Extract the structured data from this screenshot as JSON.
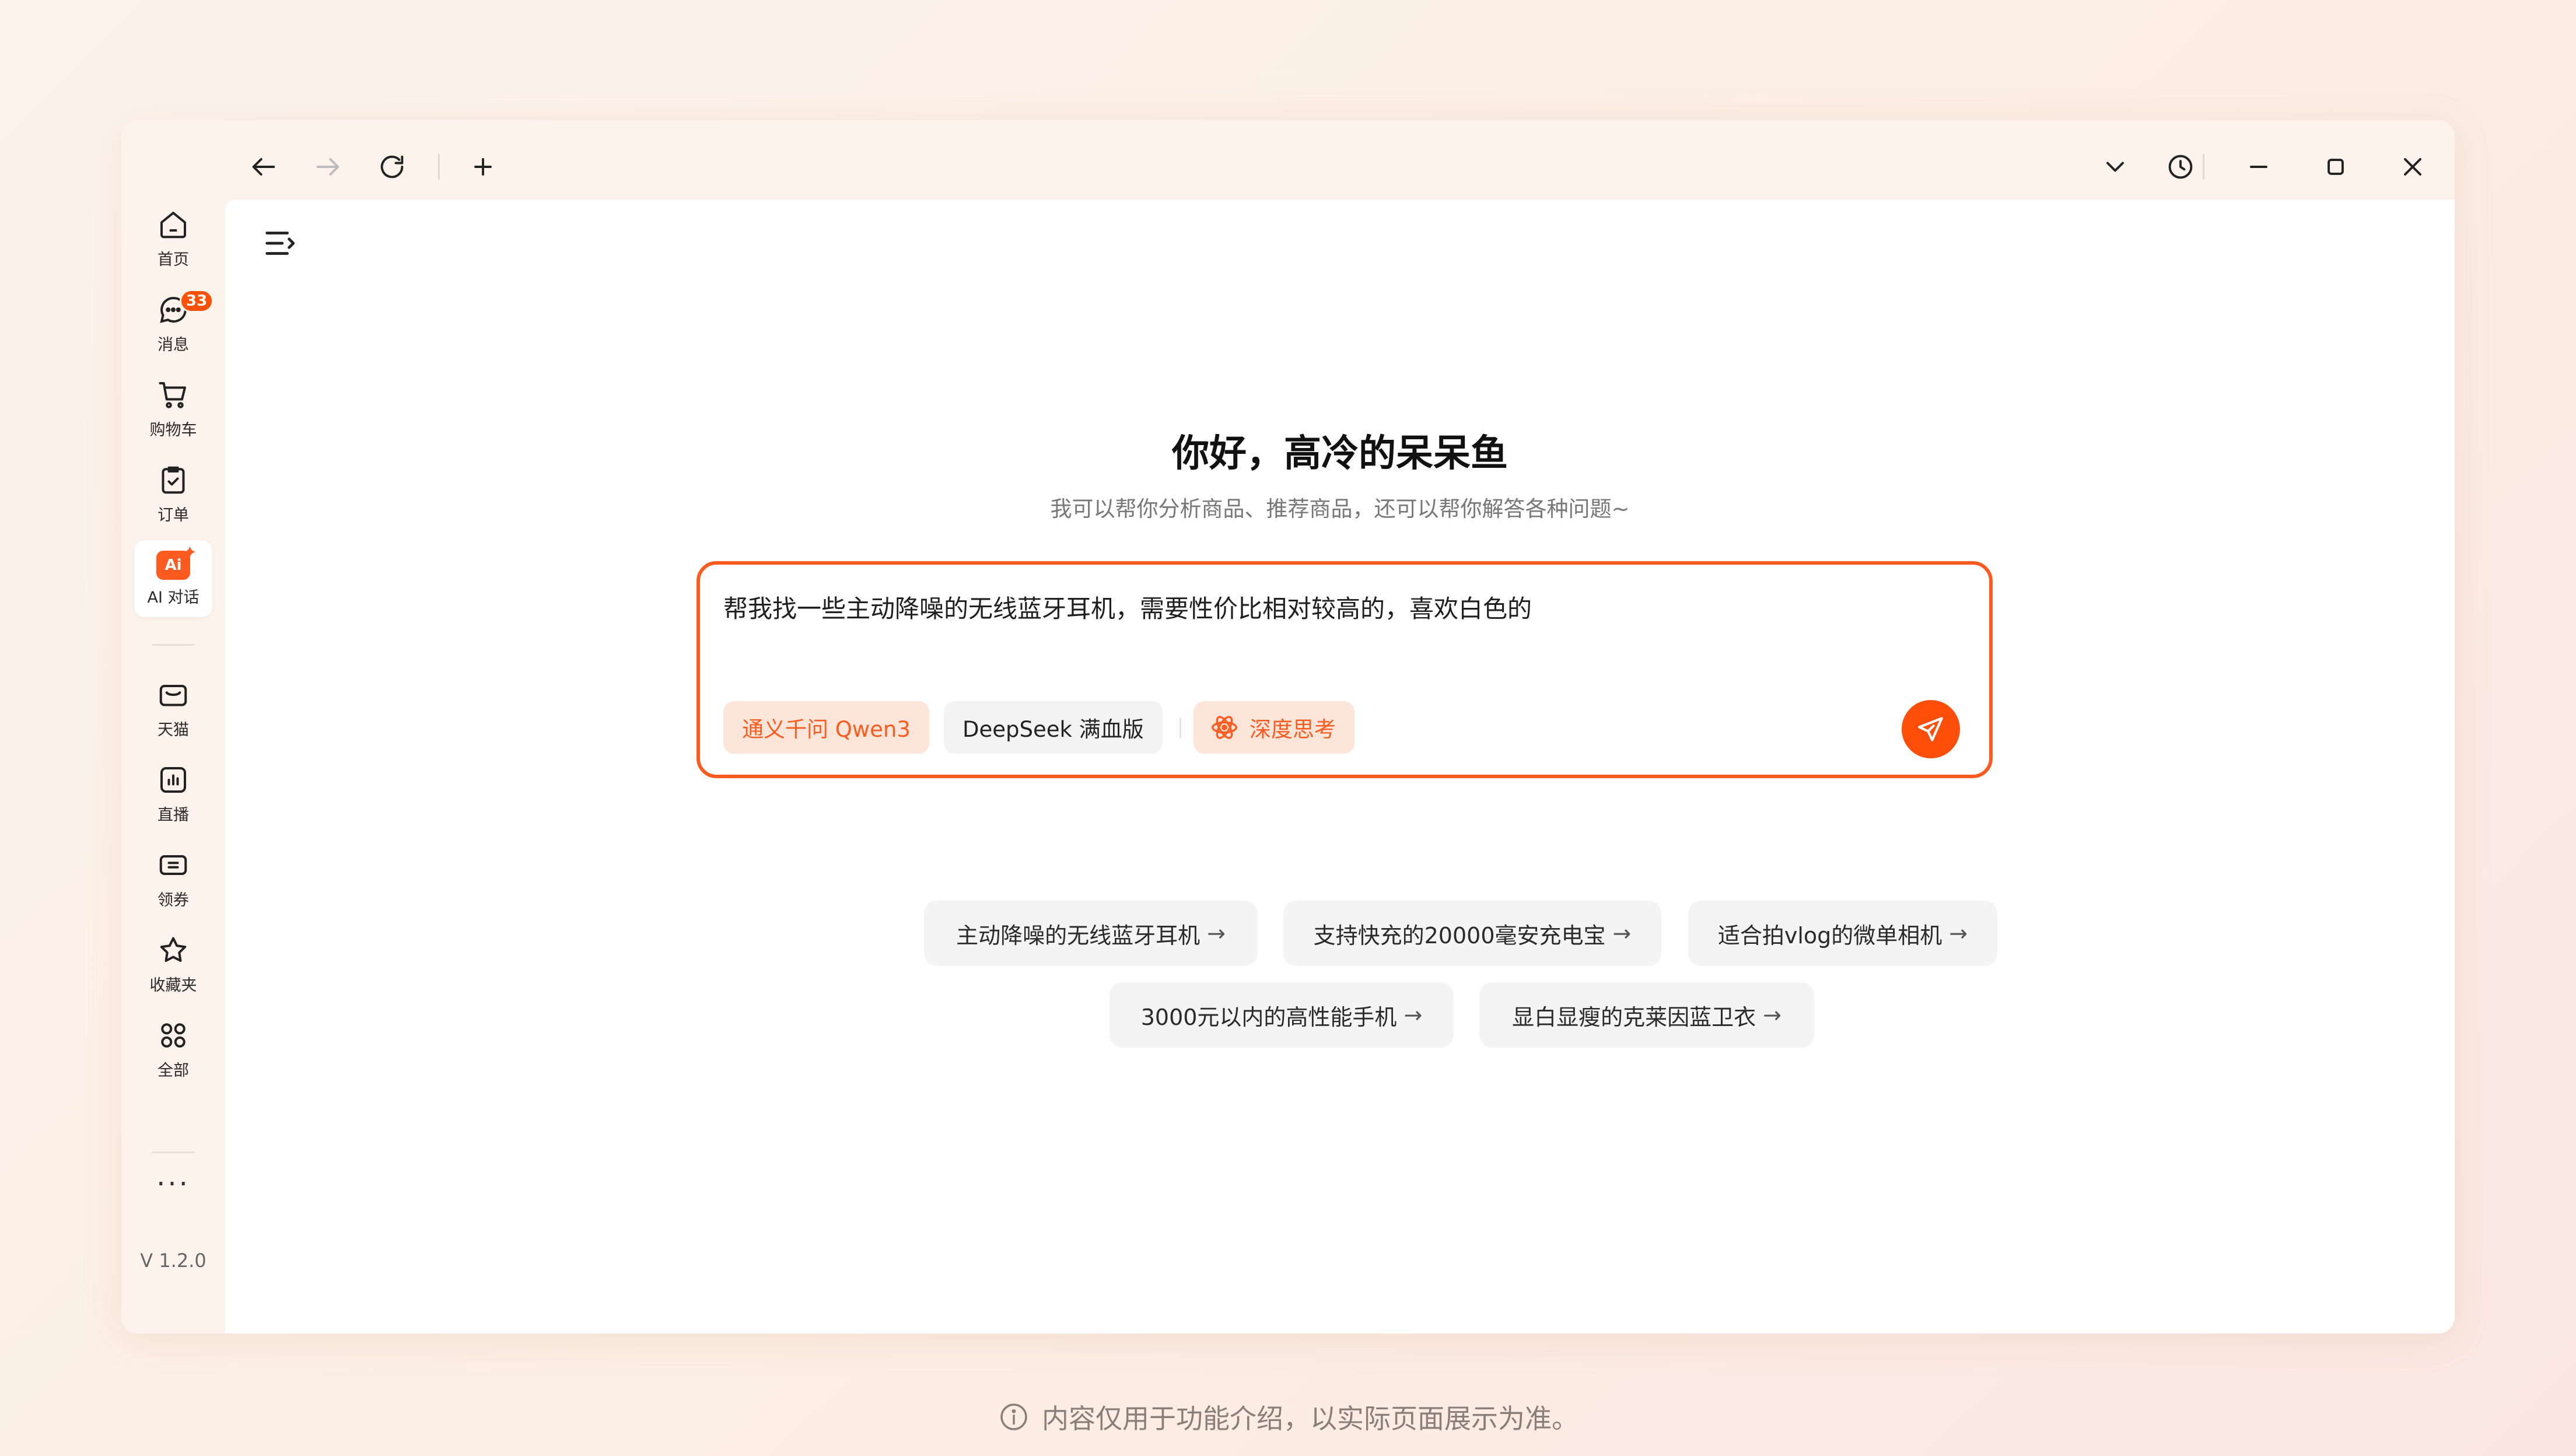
{
  "toolbar": {
    "back_icon": "arrow-left-icon",
    "forward_icon": "arrow-right-icon",
    "refresh_icon": "refresh-icon",
    "new_tab_icon": "plus-icon",
    "dropdown_icon": "chevron-down-icon",
    "history_icon": "clock-icon",
    "minimize_icon": "minimize-icon",
    "maximize_icon": "maximize-icon",
    "close_icon": "close-icon"
  },
  "sidebar": {
    "items": [
      {
        "label": "首页",
        "icon": "home-icon"
      },
      {
        "label": "消息",
        "icon": "message-icon",
        "badge": "33"
      },
      {
        "label": "购物车",
        "icon": "cart-icon"
      },
      {
        "label": "订单",
        "icon": "order-icon"
      },
      {
        "label": "AI 对话",
        "icon": "ai-chat-icon",
        "icon_text": "Ai"
      },
      {
        "label": "天猫",
        "icon": "tmall-icon"
      },
      {
        "label": "直播",
        "icon": "live-icon"
      },
      {
        "label": "领券",
        "icon": "coupon-icon"
      },
      {
        "label": "收藏夹",
        "icon": "star-icon"
      },
      {
        "label": "全部",
        "icon": "grid-icon"
      }
    ],
    "more": "···",
    "version": "V 1.2.0"
  },
  "main": {
    "greeting": "你好，高冷的呆呆鱼",
    "subtitle": "我可以帮你分析商品、推荐商品，还可以帮你解答各种问题~",
    "input_text": "帮我找一些主动降噪的无线蓝牙耳机，需要性价比相对较高的，喜欢白色的",
    "models": [
      "通义千问 Qwen3",
      "DeepSeek 满血版"
    ],
    "deep_think": "深度思考",
    "suggestions": [
      "主动降噪的无线蓝牙耳机",
      "支持快充的20000毫安充电宝",
      "适合拍vlog的微单相机",
      "3000元以内的高性能手机",
      "显白显瘦的克莱因蓝卫衣"
    ],
    "arrow": "→"
  },
  "footer": {
    "notice": "内容仅用于功能介绍，以实际页面展示为准。"
  },
  "colors": {
    "accent": "#ff5a1f",
    "badge": "#ff5000"
  }
}
